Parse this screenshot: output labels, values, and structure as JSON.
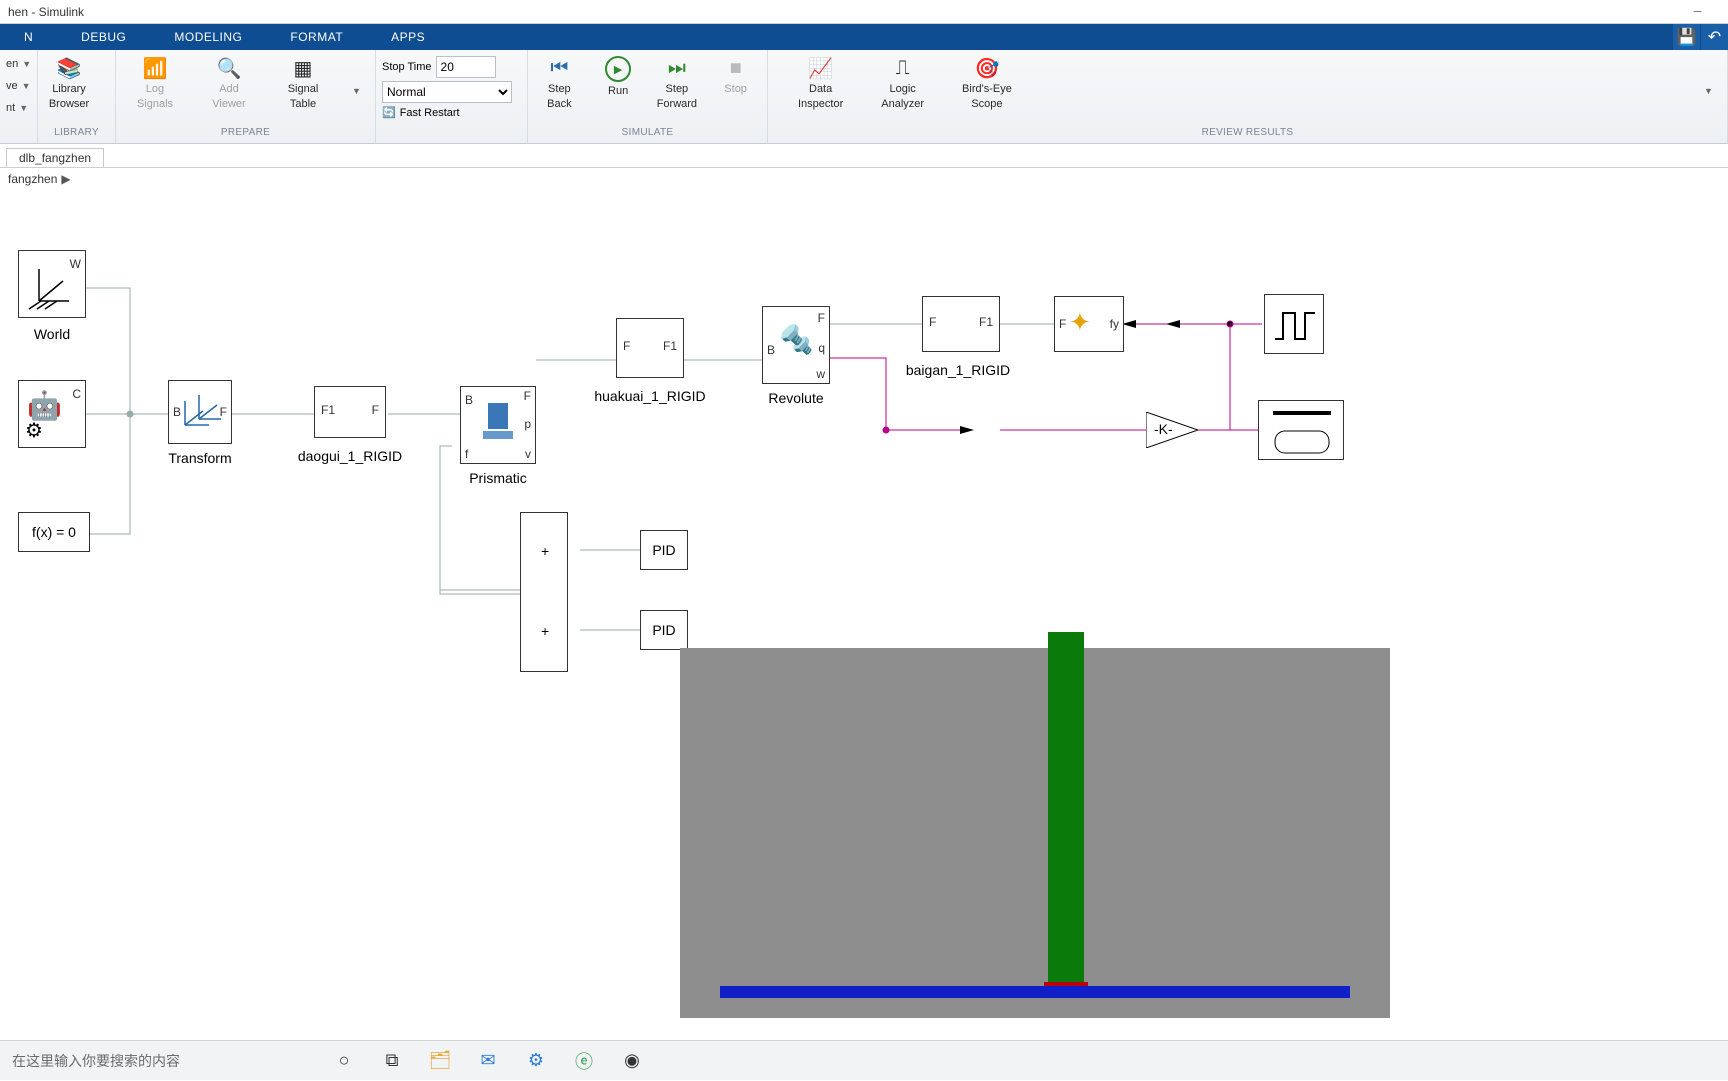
{
  "window": {
    "title": "hen - Simulink"
  },
  "menu_tabs": {
    "simulation": "N",
    "debug": "DEBUG",
    "modeling": "MODELING",
    "format": "FORMAT",
    "apps": "APPS"
  },
  "toolstrip": {
    "file": {
      "open": "en",
      "save": "ve",
      "print": "nt"
    },
    "library": {
      "library_btn": "Library",
      "browser_btn": "Browser",
      "section_label": "LIBRARY"
    },
    "prepare": {
      "log_signals": "Log\nSignals",
      "add_viewer": "Add\nViewer",
      "signal_table": "Signal\nTable",
      "section_label": "PREPARE"
    },
    "simulate": {
      "stop_time_label": "Stop Time",
      "stop_time_value": "20",
      "mode_value": "Normal",
      "fast_restart": "Fast Restart",
      "step_back": "Step\nBack",
      "run": "Run",
      "step_forward": "Step\nForward",
      "stop": "Stop",
      "section_label": "SIMULATE"
    },
    "review": {
      "data_inspector": "Data\nInspector",
      "logic_analyzer": "Logic\nAnalyzer",
      "birds_eye": "Bird's-Eye\nScope",
      "section_label": "REVIEW RESULTS"
    }
  },
  "file_tabs": {
    "tab1": "dlb_fangzhen"
  },
  "breadcrumb": {
    "root": "fangzhen"
  },
  "blocks": {
    "world": {
      "label": "World",
      "port_w": "W"
    },
    "mech_config": {
      "port_c": "C"
    },
    "solver": {
      "text": "f(x) = 0"
    },
    "transform": {
      "label": "Transform",
      "port_b": "B",
      "port_f": "F"
    },
    "daogui": {
      "label": "daogui_1_RIGID",
      "port_f1": "F1",
      "port_f": "F"
    },
    "prismatic": {
      "label": "Prismatic",
      "port_b": "B",
      "port_f": "F",
      "p": "p",
      "v": "v",
      "f": "f"
    },
    "huakuai": {
      "label": "huakuai_1_RIGID",
      "port_f": "F",
      "port_f1": "F1"
    },
    "revolute": {
      "label": "Revolute",
      "port_b": "B",
      "port_f": "F",
      "q": "q",
      "w": "w"
    },
    "baigan": {
      "label": "baigan_1_RIGID",
      "port_f": "F",
      "port_f1": "F1"
    },
    "ext_force": {
      "port_f": "F",
      "fy": "fy"
    },
    "gain_k": {
      "text": "-K-"
    },
    "pid1": {
      "text": "PID"
    },
    "pid2": {
      "text": "PID"
    },
    "sum_plus1": "+",
    "sum_plus2": "+"
  },
  "viewer3d": {
    "axes": ""
  },
  "taskbar": {
    "search_placeholder": "在这里输入你要搜索的内容"
  }
}
